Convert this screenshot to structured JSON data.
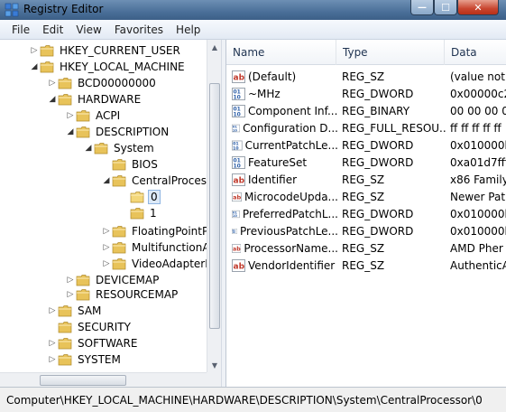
{
  "window": {
    "title": "Registry Editor",
    "minimize_glyph": "—",
    "maximize_glyph": "☐",
    "close_glyph": "✕"
  },
  "menu": [
    "File",
    "Edit",
    "View",
    "Favorites",
    "Help"
  ],
  "tree": [
    {
      "label": "HKEY_CURRENT_USER",
      "arrow": "collapsed"
    },
    {
      "label": "HKEY_LOCAL_MACHINE",
      "arrow": "expanded"
    },
    {
      "label": "BCD00000000",
      "arrow": "collapsed"
    },
    {
      "label": "HARDWARE",
      "arrow": "expanded"
    },
    {
      "label": "ACPI",
      "arrow": "collapsed"
    },
    {
      "label": "DESCRIPTION",
      "arrow": "expanded"
    },
    {
      "label": "System",
      "arrow": "expanded"
    },
    {
      "label": "BIOS",
      "arrow": "none"
    },
    {
      "label": "CentralProcessor",
      "arrow": "expanded"
    },
    {
      "label": "0",
      "arrow": "none",
      "selected": true
    },
    {
      "label": "1",
      "arrow": "none"
    },
    {
      "label": "FloatingPointProcessor",
      "arrow": "collapsed"
    },
    {
      "label": "MultifunctionAdapter",
      "arrow": "collapsed"
    },
    {
      "label": "VideoAdapterBusses",
      "arrow": "collapsed"
    },
    {
      "label": "DEVICEMAP",
      "arrow": "collapsed"
    },
    {
      "label": "RESOURCEMAP",
      "arrow": "collapsed"
    },
    {
      "label": "SAM",
      "arrow": "collapsed"
    },
    {
      "label": "SECURITY",
      "arrow": "none"
    },
    {
      "label": "SOFTWARE",
      "arrow": "collapsed"
    },
    {
      "label": "SYSTEM",
      "arrow": "collapsed"
    }
  ],
  "list": {
    "columns": [
      "Name",
      "Type",
      "Data"
    ],
    "rows": [
      {
        "icon": "string-value-icon",
        "name": "(Default)",
        "type": "REG_SZ",
        "data": "(value not"
      },
      {
        "icon": "binary-value-icon",
        "name": "~MHz",
        "type": "REG_DWORD",
        "data": "0x00000c2"
      },
      {
        "icon": "binary-value-icon",
        "name": "Component Inf...",
        "type": "REG_BINARY",
        "data": "00 00 00 00"
      },
      {
        "icon": "binary-value-icon",
        "name": "Configuration D...",
        "type": "REG_FULL_RESOU...",
        "data": "ff ff ff ff ff"
      },
      {
        "icon": "binary-value-icon",
        "name": "CurrentPatchLe...",
        "type": "REG_DWORD",
        "data": "0x010000b"
      },
      {
        "icon": "binary-value-icon",
        "name": "FeatureSet",
        "type": "REG_DWORD",
        "data": "0xa01d7fff"
      },
      {
        "icon": "string-value-icon",
        "name": "Identifier",
        "type": "REG_SZ",
        "data": "x86 Family"
      },
      {
        "icon": "string-value-icon",
        "name": "MicrocodeUpda...",
        "type": "REG_SZ",
        "data": "Newer Pat"
      },
      {
        "icon": "binary-value-icon",
        "name": "PreferredPatchL...",
        "type": "REG_DWORD",
        "data": "0x010000b"
      },
      {
        "icon": "binary-value-icon",
        "name": "PreviousPatchLe...",
        "type": "REG_DWORD",
        "data": "0x010000b"
      },
      {
        "icon": "string-value-icon",
        "name": "ProcessorName...",
        "type": "REG_SZ",
        "data": "AMD Pher"
      },
      {
        "icon": "string-value-icon",
        "name": "VendorIdentifier",
        "type": "REG_SZ",
        "data": "AuthenticA"
      }
    ]
  },
  "status": "Computer\\HKEY_LOCAL_MACHINE\\HARDWARE\\DESCRIPTION\\System\\CentralProcessor\\0",
  "colors": {
    "folder": "#e8c35a",
    "folder_open": "#f3d77a",
    "string_icon": "#c0392b",
    "binary_icon": "#2b5ea8",
    "selection": "#dce9f8"
  }
}
